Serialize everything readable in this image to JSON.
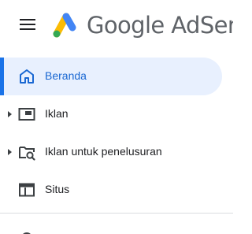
{
  "header": {
    "menu_icon": "hamburger-menu-icon",
    "logo_icon": "adsense-logo-icon",
    "logo_text": "Google AdSense"
  },
  "nav": {
    "items": [
      {
        "label": "Beranda",
        "icon": "home-icon",
        "active": true,
        "expandable": false
      },
      {
        "label": "Iklan",
        "icon": "ad-unit-icon",
        "active": false,
        "expandable": true
      },
      {
        "label": "Iklan untuk penelusuran",
        "icon": "search-ads-icon",
        "active": false,
        "expandable": true
      },
      {
        "label": "Situs",
        "icon": "sites-icon",
        "active": false,
        "expandable": false
      }
    ]
  },
  "colors": {
    "accent": "#1a73e8",
    "active_background": "#e8f0fe",
    "active_text": "#1967d2",
    "text": "#202124",
    "icon": "#3c4043",
    "logo_text": "#5f6368",
    "logo_yellow": "#fbbc04",
    "logo_blue": "#4285f4",
    "logo_green": "#34a853"
  }
}
